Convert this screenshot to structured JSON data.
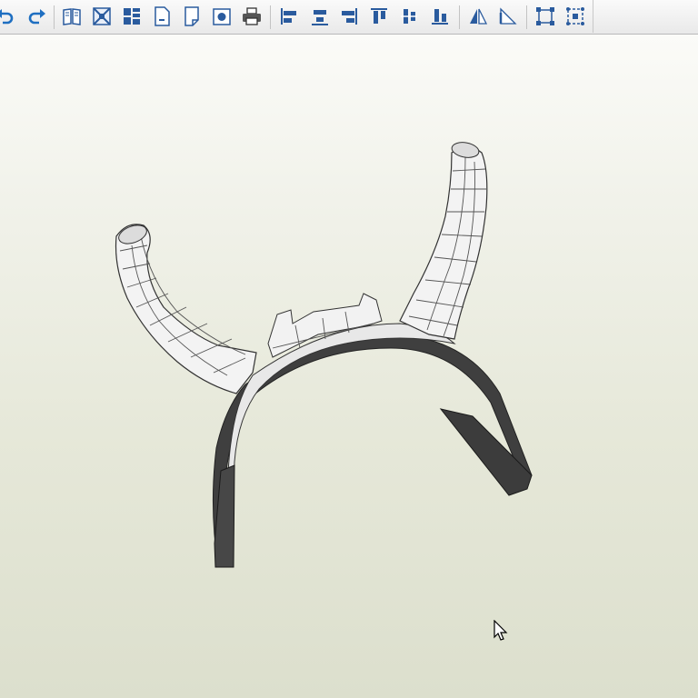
{
  "app": {
    "name": ""
  },
  "toolbar": {
    "buttons": [
      {
        "name": "undo-button",
        "icon": "undo-icon"
      },
      {
        "name": "redo-button",
        "icon": "redo-icon"
      },
      {
        "name": "open-unfold-button",
        "icon": "book-icon"
      },
      {
        "name": "unfold-button",
        "icon": "unfold-icon"
      },
      {
        "name": "layout-button",
        "icon": "grid-icon"
      },
      {
        "name": "new-page-button",
        "icon": "page-icon"
      },
      {
        "name": "page-setup-button",
        "icon": "page-setup-icon"
      },
      {
        "name": "photo-button",
        "icon": "camera-icon"
      },
      {
        "name": "print-button",
        "icon": "printer-icon"
      },
      {
        "name": "align-left-button",
        "icon": "align-left-icon"
      },
      {
        "name": "align-center-button",
        "icon": "align-center-icon"
      },
      {
        "name": "align-right-button",
        "icon": "align-right-icon"
      },
      {
        "name": "align-top-button",
        "icon": "align-top-icon"
      },
      {
        "name": "align-middle-button",
        "icon": "align-middle-icon"
      },
      {
        "name": "align-bottom-button",
        "icon": "align-bottom-icon"
      },
      {
        "name": "flip-h-button",
        "icon": "flip-horizontal-icon"
      },
      {
        "name": "flip-v-button",
        "icon": "flip-vertical-icon"
      },
      {
        "name": "select-frame-button",
        "icon": "frame-select-icon"
      },
      {
        "name": "select-all-button",
        "icon": "select-all-icon"
      }
    ]
  },
  "colors": {
    "accent": "#1f6fc1",
    "viewport_bottom": "#dcdfcd",
    "mesh_light": "#f4f4f4",
    "mesh_dark": "#4a4a4a"
  },
  "viewport": {
    "label": ""
  }
}
